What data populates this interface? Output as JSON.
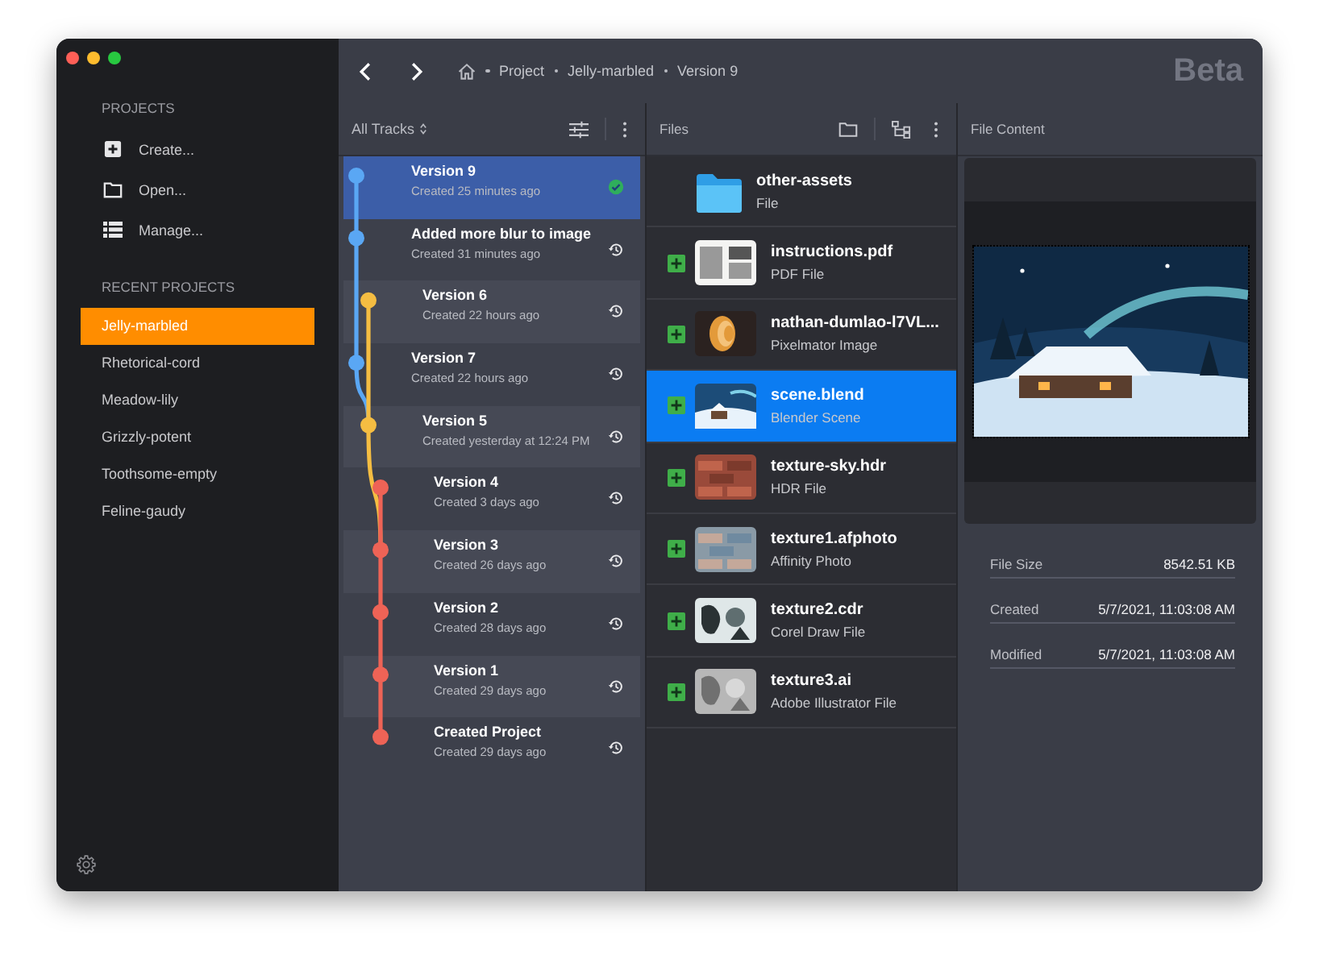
{
  "sidebar": {
    "sections": [
      {
        "title": "PROJECTS",
        "items": [
          {
            "label": "Create...",
            "kind": "create"
          },
          {
            "label": "Open...",
            "kind": "open"
          },
          {
            "label": "Manage...",
            "kind": "manage"
          }
        ]
      },
      {
        "title": "RECENT PROJECTS",
        "items": [
          {
            "label": "Jelly-marbled",
            "selected": true
          },
          {
            "label": "Rhetorical-cord",
            "selected": false
          },
          {
            "label": "Meadow-lily",
            "selected": false
          },
          {
            "label": "Grizzly-potent",
            "selected": false
          },
          {
            "label": "Toothsome-empty",
            "selected": false
          },
          {
            "label": "Feline-gaudy",
            "selected": false
          }
        ]
      }
    ]
  },
  "toolbar": {
    "breadcrumb": [
      "Project",
      "Jelly-marbled",
      "Version 9"
    ],
    "badge": "Beta"
  },
  "tracks": {
    "filter": "All Tracks",
    "versions": [
      {
        "title": "Version 9",
        "subtitle": "Created 25 minutes ago",
        "color": "#5aa7f4",
        "selected": true
      },
      {
        "title": "Added more blur to image",
        "subtitle": "Created 31 minutes ago",
        "color": "#5aa7f4",
        "selected": false
      },
      {
        "title": "Version 6",
        "subtitle": "Created 22 hours ago",
        "color": "#f5bd42",
        "selected": false
      },
      {
        "title": "Version 7",
        "subtitle": "Created 22 hours ago",
        "color": "#5aa7f4",
        "selected": false
      },
      {
        "title": "Version 5",
        "subtitle": "Created yesterday at 12:24 PM",
        "color": "#f5bd42",
        "selected": false
      },
      {
        "title": "Version 4",
        "subtitle": "Created 3 days ago",
        "color": "#ee6356",
        "selected": false
      },
      {
        "title": "Version 3",
        "subtitle": "Created 26 days ago",
        "color": "#ee6356",
        "selected": false
      },
      {
        "title": "Version 2",
        "subtitle": "Created 28 days ago",
        "color": "#ee6356",
        "selected": false
      },
      {
        "title": "Version 1",
        "subtitle": "Created 29 days ago",
        "color": "#ee6356",
        "selected": false
      },
      {
        "title": "Created Project",
        "subtitle": "Created 29 days ago",
        "color": "#ee6356",
        "selected": false
      }
    ]
  },
  "files": {
    "title": "Files",
    "items": [
      {
        "name": "other-assets",
        "type": "File",
        "kind": "folder",
        "selected": false
      },
      {
        "name": "instructions.pdf",
        "type": "PDF File",
        "kind": "file",
        "selected": false
      },
      {
        "name": "nathan-dumlao-l7VL...",
        "type": "Pixelmator Image",
        "kind": "file",
        "selected": false
      },
      {
        "name": "scene.blend",
        "type": "Blender Scene",
        "kind": "file",
        "selected": true
      },
      {
        "name": "texture-sky.hdr",
        "type": "HDR File",
        "kind": "file",
        "selected": false
      },
      {
        "name": "texture1.afphoto",
        "type": "Affinity Photo",
        "kind": "file",
        "selected": false
      },
      {
        "name": "texture2.cdr",
        "type": "Corel Draw File",
        "kind": "file",
        "selected": false
      },
      {
        "name": "texture3.ai",
        "type": "Adobe Illustrator File",
        "kind": "file",
        "selected": false
      }
    ]
  },
  "content": {
    "title": "File Content",
    "details": [
      {
        "label": "File Size",
        "value": "8542.51 KB"
      },
      {
        "label": "Created",
        "value": "5/7/2021, 11:03:08 AM"
      },
      {
        "label": "Modified",
        "value": "5/7/2021, 11:03:08 AM"
      }
    ]
  }
}
